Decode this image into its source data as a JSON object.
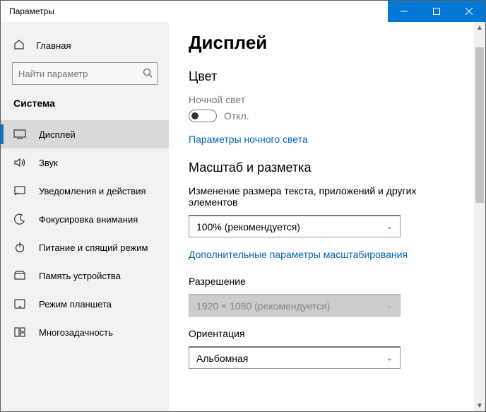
{
  "window": {
    "title": "Параметры"
  },
  "sidebar": {
    "home": "Главная",
    "search_placeholder": "Найти параметр",
    "section": "Система",
    "items": [
      {
        "label": "Дисплей"
      },
      {
        "label": "Звук"
      },
      {
        "label": "Уведомления и действия"
      },
      {
        "label": "Фокусировка внимания"
      },
      {
        "label": "Питание и спящий режим"
      },
      {
        "label": "Память устройства"
      },
      {
        "label": "Режим планшета"
      },
      {
        "label": "Многозадачность"
      }
    ]
  },
  "page": {
    "title": "Дисплей",
    "color_section": "Цвет",
    "night_light_label": "Ночной свет",
    "night_light_state": "Откл.",
    "night_light_link": "Параметры ночного света",
    "scale_section": "Масштаб и разметка",
    "scale_label": "Изменение размера текста, приложений и других элементов",
    "scale_value": "100% (рекомендуется)",
    "scale_link": "Дополнительные параметры масштабирования",
    "resolution_label": "Разрешение",
    "resolution_value": "1920 × 1080 (рекомендуется)",
    "orientation_label": "Ориентация",
    "orientation_value": "Альбомная"
  }
}
